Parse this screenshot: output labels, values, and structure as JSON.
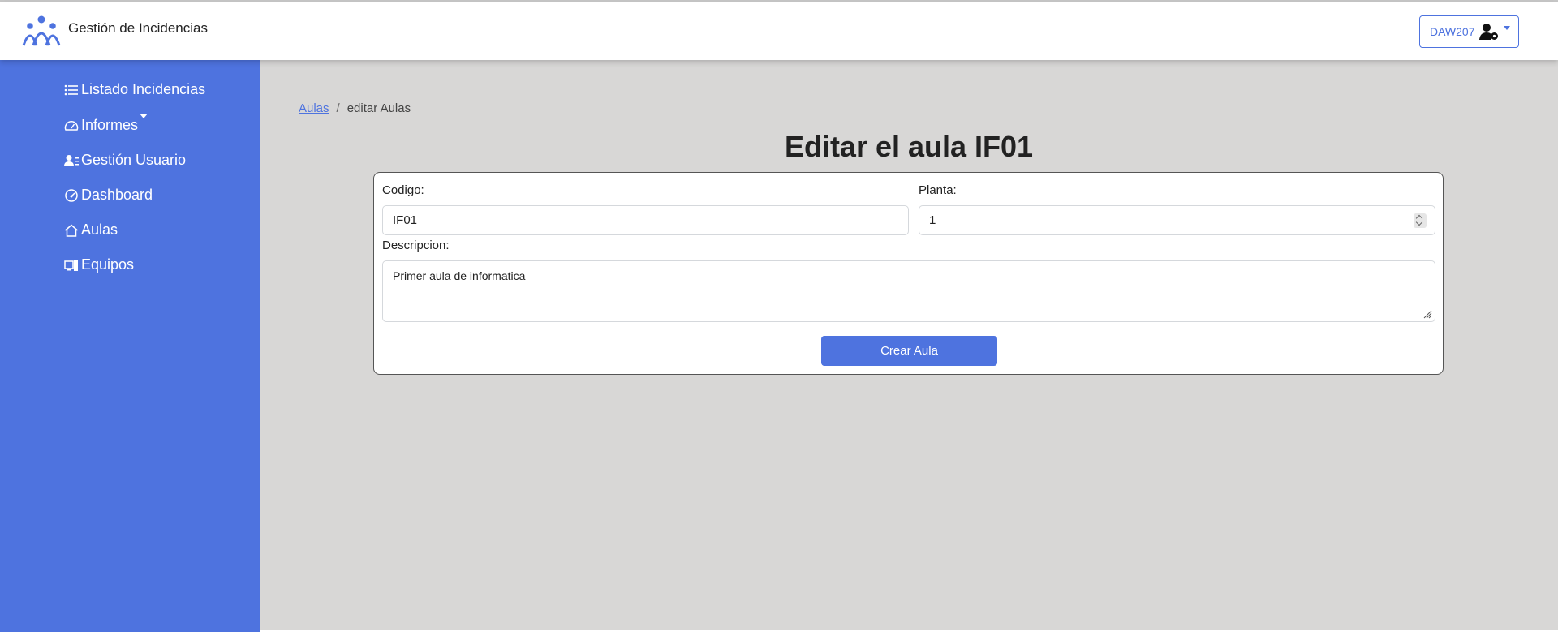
{
  "app": {
    "title": "Gestión de Incidencias",
    "logo_icon": "people-group-icon"
  },
  "user_menu": {
    "label": "DAW207",
    "icon": "user-gear-icon"
  },
  "sidebar": {
    "items": [
      {
        "label": "Listado Incidencias",
        "icon": "list-icon"
      },
      {
        "label": "Informes",
        "icon": "gauge-icon",
        "has_dropdown": true
      },
      {
        "label": "Gestión Usuario",
        "icon": "user-lines-icon"
      },
      {
        "label": "Dashboard",
        "icon": "dashboard-icon"
      },
      {
        "label": "Aulas",
        "icon": "house-icon"
      },
      {
        "label": "Equipos",
        "icon": "devices-icon"
      }
    ]
  },
  "breadcrumb": {
    "link": "Aulas",
    "separator": "/",
    "current": "editar Aulas"
  },
  "page": {
    "title": "Editar el aula IF01"
  },
  "form": {
    "codigo_label": "Codigo:",
    "codigo_value": "IF01",
    "planta_label": "Planta:",
    "planta_value": "1",
    "descripcion_label": "Descripcion:",
    "descripcion_value": "Primer aula de informatica",
    "submit_label": "Crear Aula"
  },
  "colors": {
    "primary": "#4e73df",
    "background": "#d8d7d6"
  }
}
